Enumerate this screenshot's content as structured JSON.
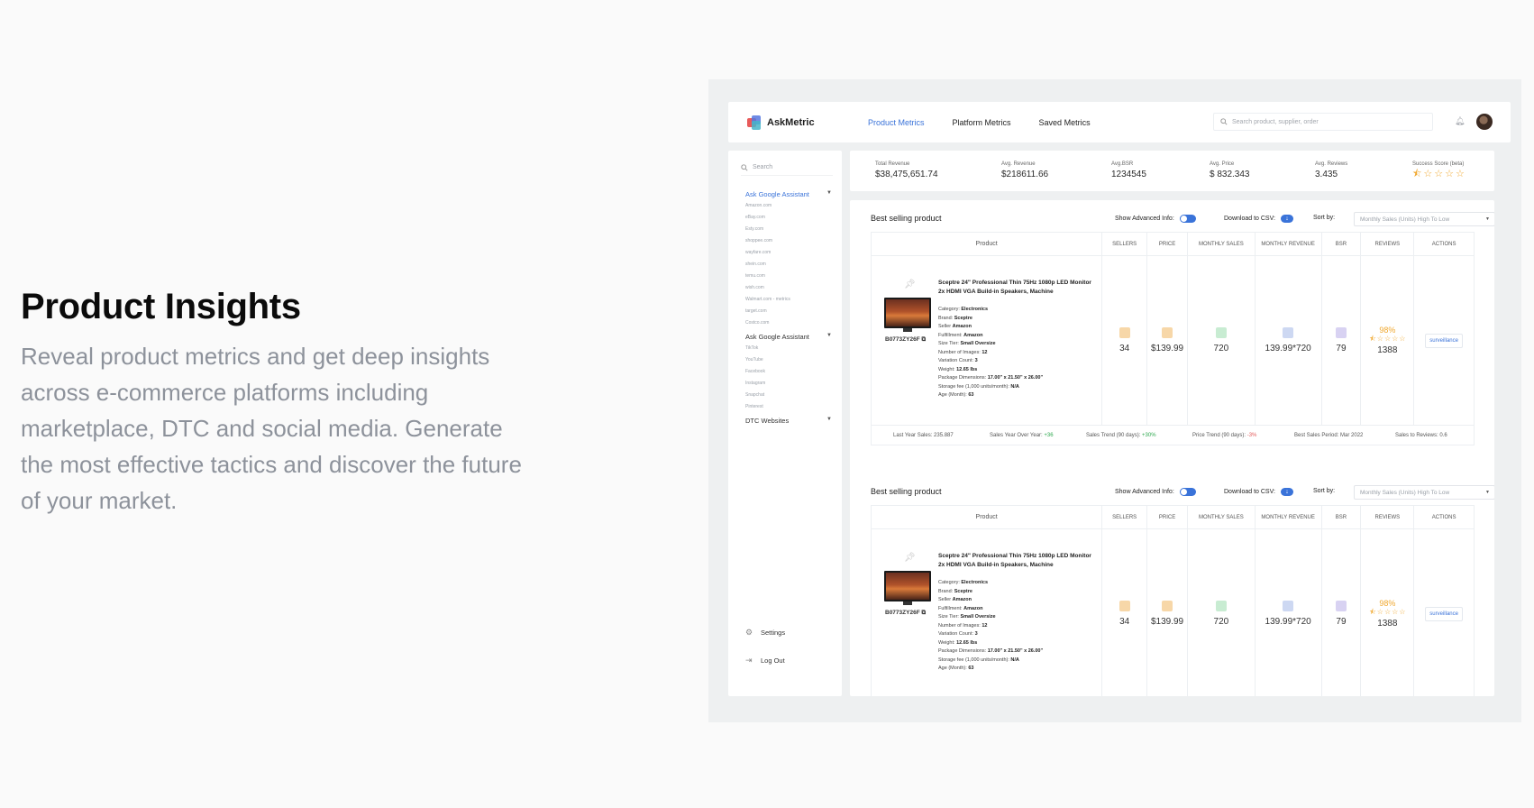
{
  "hero": {
    "title": "Product Insights",
    "description": "Reveal product metrics and get deep insights across e-commerce platforms including marketplace, DTC and social media. Generate the most effective tactics and discover the future of your market."
  },
  "app": {
    "name": "AskMetric",
    "nav": [
      "Product Metrics",
      "Platform Metrics",
      "Saved Metrics"
    ],
    "active_nav": "Product Metrics",
    "search_placeholder": "Search product, supplier, order"
  },
  "sidebar": {
    "search_placeholder": "Search",
    "groups": [
      {
        "label": "Ask Google Assistant",
        "items": [
          "Amazon.com",
          "eBay.com",
          "Esty.com",
          "shoppee.com",
          "wayfare.com",
          "shein.com",
          "temu.com",
          "wish.com",
          "Walmart.com - metrics",
          "target.com",
          "Costco.com"
        ]
      },
      {
        "label": "Ask Google Assistant",
        "items": [
          "TikTok",
          "YouTube",
          "Facebook",
          "Instagram",
          "Snapchat",
          "Pinterest"
        ]
      },
      {
        "label": "DTC Websites",
        "items": []
      }
    ],
    "settings": "Settings",
    "logout": "Log Out"
  },
  "stats": [
    {
      "label": "Total Revenue",
      "value": "$38,475,651.74"
    },
    {
      "label": "Avg. Revenue",
      "value": "$218611.66"
    },
    {
      "label": "Avg.BSR",
      "value": "1234545"
    },
    {
      "label": "Avg. Price",
      "value": "$ 832.343"
    },
    {
      "label": "Avg. Reviews",
      "value": "3.435"
    },
    {
      "label": "Success Score (beta)",
      "stars": 5
    }
  ],
  "cards": [
    {
      "title": "Best selling product",
      "advanced_label": "Show Advanced Info:",
      "csv_label": "Download to CSV:",
      "sort_label": "Sort by:",
      "sort_value": "Monthly Sales (Units) High To Low",
      "columns": [
        "Product",
        "SELLERS",
        "PRICE",
        "MONTHLY SALES",
        "MONTHLY REVENUE",
        "BSR",
        "REVIEWS",
        "ACTIONS"
      ],
      "product": {
        "sku": "B0773ZY26F",
        "title": "Sceptre 24\" Professional Thin 75Hz 1080p LED Monitor 2x HDMI VGA Build-in Speakers, Machine",
        "details": [
          {
            "k": "Category:",
            "v": "Electronics"
          },
          {
            "k": "Brand:",
            "v": "Sceptre"
          },
          {
            "k": "Seller",
            "v": "Amazon"
          },
          {
            "k": "Fulfillment:",
            "v": "Amazon"
          },
          {
            "k": "Size Tier:",
            "v": "Small Oversize"
          },
          {
            "k": "Number of Images:",
            "v": "12"
          },
          {
            "k": "Variation Count:",
            "v": "3"
          },
          {
            "k": "Weight:",
            "v": "12.65 lbs"
          },
          {
            "k": "Package Dimensions:",
            "v": "17.00\" x 21.50\" x 26.00\""
          },
          {
            "k": "Storage fee (1,000 units/month):",
            "v": "N/A"
          },
          {
            "k": "Age (Month):",
            "v": "63"
          }
        ]
      },
      "sellers": "34",
      "price": "$139.99",
      "monthly_sales": "720",
      "monthly_revenue": "139.99*720",
      "bsr": "79",
      "review_pct": "98%",
      "review_count": "1388",
      "action": "surveillance",
      "footer": {
        "last_year": "Last Year Sales: 235.887",
        "yoy_label": "Sales Year Over Year:",
        "yoy_value": "+36",
        "trend_label": "Sales Trend (90 days):",
        "trend_value": "+30%",
        "price_trend_label": "Price Trend (90 days):",
        "price_trend_value": "-3%",
        "best_period": "Best Sales Period: Mar 2022",
        "sales_reviews": "Sales to Reviews: 0.6"
      }
    },
    {
      "title": "Best selling product",
      "advanced_label": "Show Advanced Info:",
      "csv_label": "Download to CSV:",
      "sort_label": "Sort by:",
      "sort_value": "Monthly Sales (Units) High To Low",
      "columns": [
        "Product",
        "SELLERS",
        "PRICE",
        "MONTHLY SALES",
        "MONTHLY REVENUE",
        "BSR",
        "REVIEWS",
        "ACTIONS"
      ],
      "product": {
        "sku": "B0773ZY26F",
        "title": "Sceptre 24\" Professional Thin 75Hz 1080p LED Monitor 2x HDMI VGA Build-in Speakers, Machine",
        "details": [
          {
            "k": "Category:",
            "v": "Electronics"
          },
          {
            "k": "Brand:",
            "v": "Sceptre"
          },
          {
            "k": "Seller",
            "v": "Amazon"
          },
          {
            "k": "Fulfillment:",
            "v": "Amazon"
          },
          {
            "k": "Size Tier:",
            "v": "Small Oversize"
          },
          {
            "k": "Number of Images:",
            "v": "12"
          },
          {
            "k": "Variation Count:",
            "v": "3"
          },
          {
            "k": "Weight:",
            "v": "12.65 lbs"
          },
          {
            "k": "Package Dimensions:",
            "v": "17.00\" x 21.50\" x 26.00\""
          },
          {
            "k": "Storage fee (1,000 units/month):",
            "v": "N/A"
          },
          {
            "k": "Age (Month):",
            "v": "63"
          }
        ]
      },
      "sellers": "34",
      "price": "$139.99",
      "monthly_sales": "720",
      "monthly_revenue": "139.99*720",
      "bsr": "79",
      "review_pct": "98%",
      "review_count": "1388",
      "action": "surveillance"
    }
  ],
  "colors": {
    "accent": "#3a73d9",
    "star": "#f0a830",
    "positive": "#2fa84f",
    "negative": "#e35b5b"
  }
}
